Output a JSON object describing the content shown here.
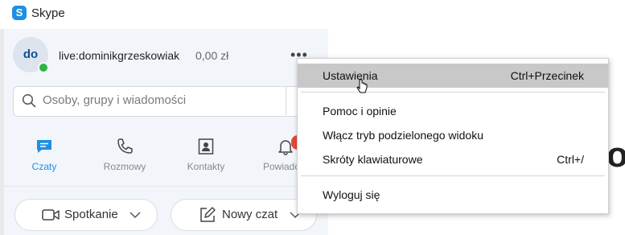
{
  "window": {
    "title": "Skype",
    "logo_letter": "S"
  },
  "profile": {
    "initials": "do",
    "username": "live:dominikgrzeskowiak",
    "balance": "0,00 zł",
    "more": "•••"
  },
  "search": {
    "placeholder": "Osoby, grupy i wiadomości"
  },
  "nav": {
    "chats": "Czaty",
    "calls": "Rozmowy",
    "contacts": "Kontakty",
    "notifications": "Powiadom"
  },
  "actions": {
    "meeting": "Spotkanie",
    "new_chat": "Nowy czat"
  },
  "menu": {
    "items": [
      {
        "label": "Ustawienia",
        "shortcut": "Ctrl+Przecinek"
      },
      {
        "label": "Pomoc i opinie",
        "shortcut": ""
      },
      {
        "label": "Włącz tryb podzielonego widoku",
        "shortcut": ""
      },
      {
        "label": "Skróty klawiaturowe",
        "shortcut": "Ctrl+/"
      },
      {
        "label": "Wyloguj się",
        "shortcut": ""
      }
    ]
  },
  "background": {
    "partial_text": "o"
  },
  "colors": {
    "accent": "#1e8fe1",
    "presence": "#2cb742",
    "badge": "#e8453c",
    "highlight": "#c8c8c8"
  }
}
